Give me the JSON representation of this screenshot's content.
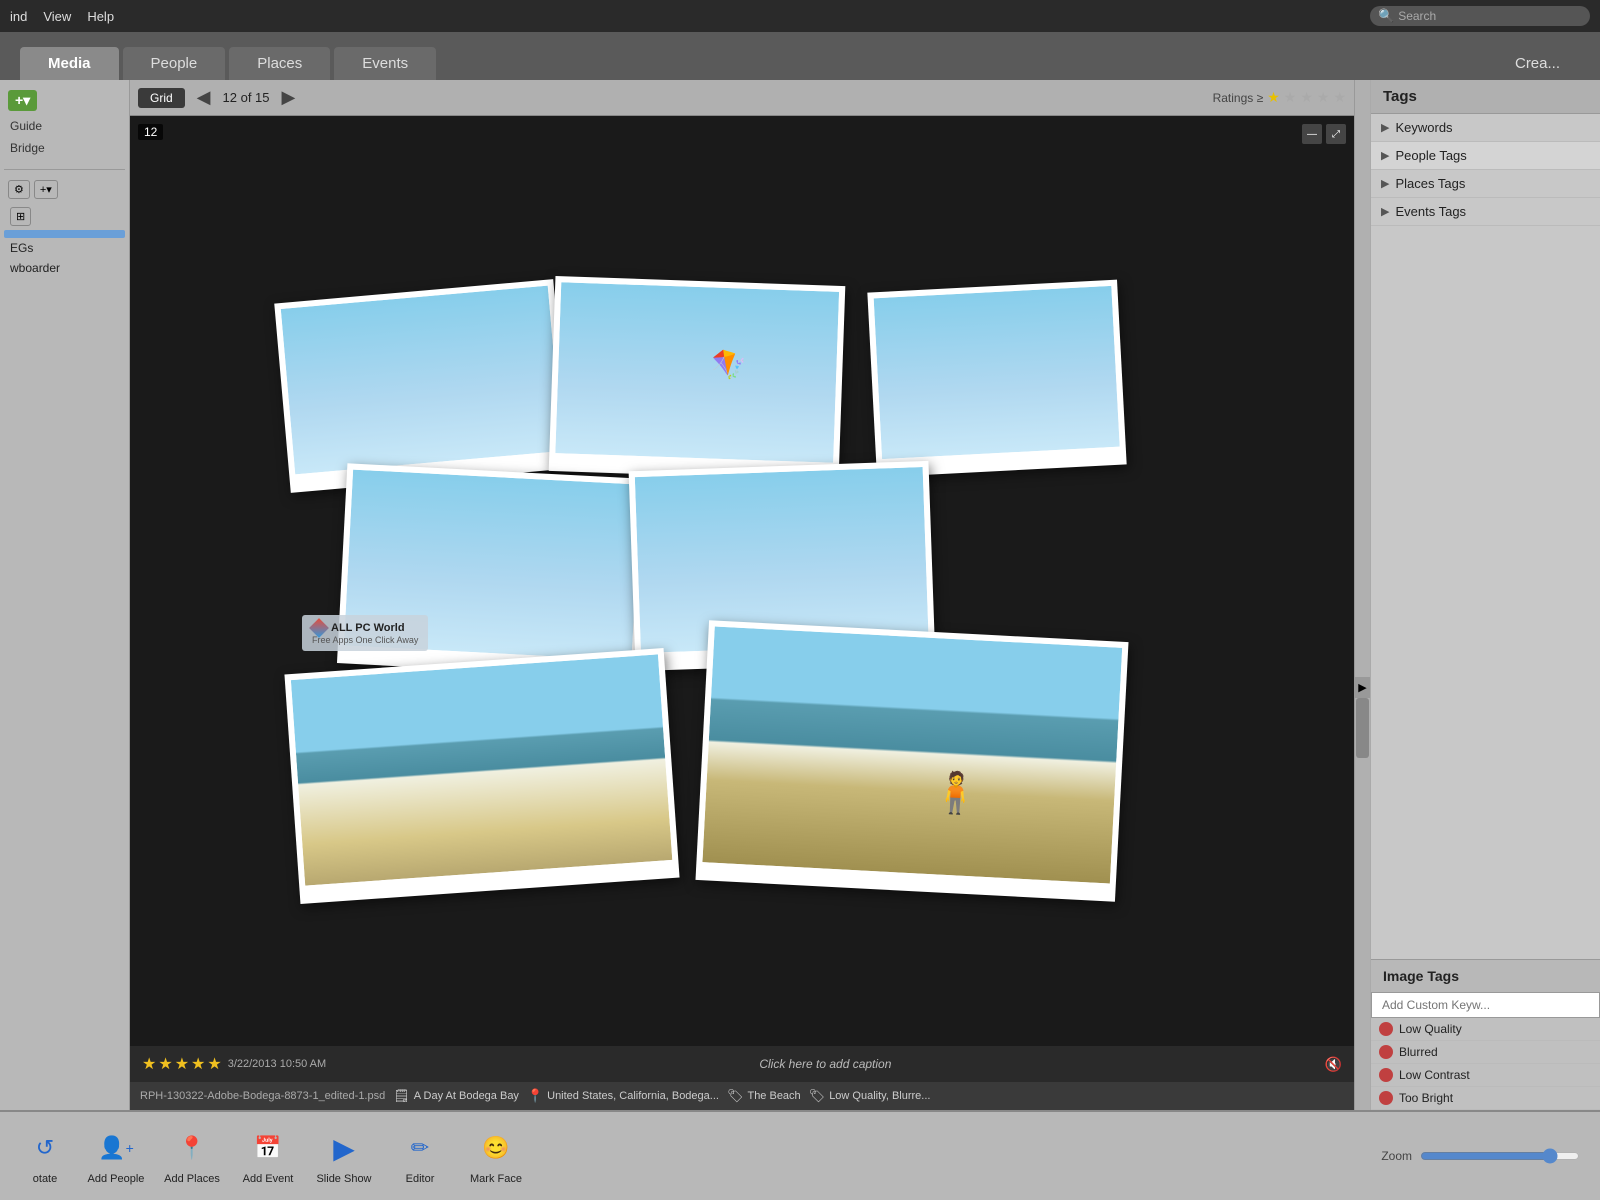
{
  "menubar": {
    "items": [
      "ind",
      "View",
      "Help"
    ],
    "search_placeholder": "Search"
  },
  "tabs": {
    "items": [
      "Media",
      "People",
      "Places",
      "Events"
    ],
    "active": "Media",
    "create_label": "Crea..."
  },
  "toolbar": {
    "grid_label": "Grid",
    "nav_prev": "◀",
    "nav_next": "▶",
    "count": "12 of 15",
    "ratings_label": "Ratings ≥",
    "stars": [
      true,
      false,
      false,
      false,
      false
    ]
  },
  "left_panel": {
    "add_label": "+▾",
    "guide_label": "Guide",
    "bridge_label": "Bridge",
    "panel_add2": "+▾",
    "items": [
      "EGs",
      "wboarder"
    ],
    "active_item": "wboarder"
  },
  "image": {
    "number": "12",
    "caption_placeholder": "Click here to add caption",
    "rating_stars": 5,
    "date_time": "3/22/2013 10:50 AM",
    "filename": "RPH-130322-Adobe-Bodega-8873-1_edited-1.psd",
    "metadata": [
      {
        "icon": "📷",
        "text": "A Day At Bodega Bay"
      },
      {
        "icon": "📍",
        "text": "United States, California, Bodega..."
      },
      {
        "icon": "🏷",
        "text": "The Beach"
      },
      {
        "icon": "🏷",
        "text": "Low Quality, Blurre..."
      }
    ],
    "watermark": {
      "title": "ALL PC World",
      "subtitle": "Free Apps One Click Away"
    }
  },
  "right_panel": {
    "header": "Tags",
    "sections": [
      {
        "label": "Keywords",
        "expanded": false
      },
      {
        "label": "People Tags",
        "expanded": true
      },
      {
        "label": "Places Tags",
        "expanded": false
      },
      {
        "label": "Events Tags",
        "expanded": false
      }
    ],
    "image_tags_header": "Image Tags",
    "add_keyword_placeholder": "Add Custom Keyw...",
    "tags": [
      {
        "label": "Low Quality"
      },
      {
        "label": "Blurred"
      },
      {
        "label": "Low Contrast"
      },
      {
        "label": "Too Bright"
      }
    ]
  },
  "bottom_toolbar": {
    "rotate_label": "otate",
    "buttons": [
      {
        "label": "Add People",
        "icon": "👤"
      },
      {
        "label": "Add Places",
        "icon": "📍"
      },
      {
        "label": "Add Event",
        "icon": "📅"
      },
      {
        "label": "Slide Show",
        "icon": "▶"
      },
      {
        "label": "Editor",
        "icon": "✏"
      },
      {
        "label": "Mark Face",
        "icon": "😊"
      }
    ],
    "zoom_label": "Zoom"
  }
}
